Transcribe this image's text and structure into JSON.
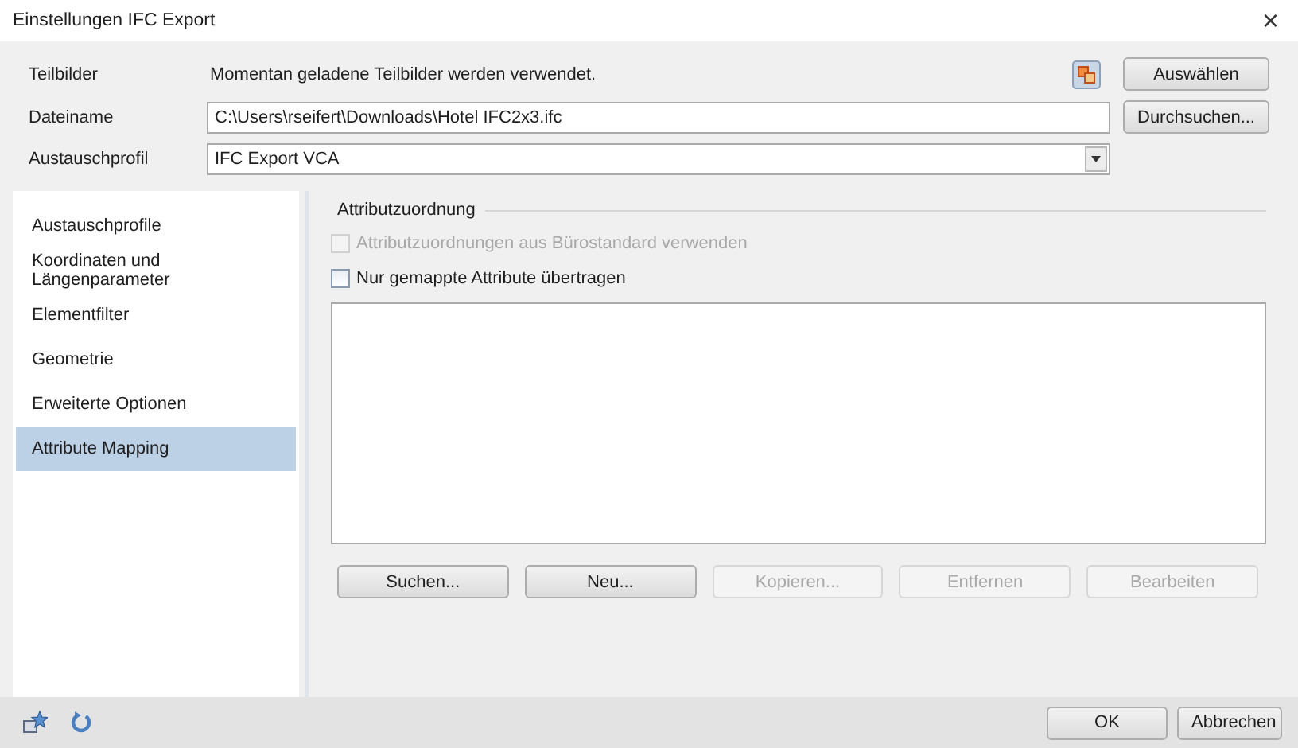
{
  "window": {
    "title": "Einstellungen IFC Export",
    "close": "×"
  },
  "form": {
    "teilbilder": {
      "label": "Teilbilder",
      "text": "Momentan geladene Teilbilder werden verwendet.",
      "button": "Auswählen"
    },
    "dateiname": {
      "label": "Dateiname",
      "value": "C:\\Users\\rseifert\\Downloads\\Hotel IFC2x3.ifc",
      "button": "Durchsuchen..."
    },
    "austauschprofil": {
      "label": "Austauschprofil",
      "value": "IFC Export VCA"
    }
  },
  "sidebar": {
    "items": [
      {
        "label": "Austauschprofile",
        "selected": false
      },
      {
        "label": "Koordinaten und Längenparameter",
        "selected": false
      },
      {
        "label": "Elementfilter",
        "selected": false
      },
      {
        "label": "Geometrie",
        "selected": false
      },
      {
        "label": "Erweiterte Optionen",
        "selected": false
      },
      {
        "label": "Attribute Mapping",
        "selected": true
      }
    ]
  },
  "panel": {
    "title": "Attributzuordnung",
    "checkboxes": [
      {
        "label": "Attributzuordnungen aus Bürostandard verwenden",
        "checked": false,
        "disabled": true
      },
      {
        "label": "Nur gemappte Attribute übertragen",
        "checked": false,
        "disabled": false
      }
    ],
    "buttons": [
      {
        "label": "Suchen...",
        "disabled": false
      },
      {
        "label": "Neu...",
        "disabled": false
      },
      {
        "label": "Kopieren...",
        "disabled": true
      },
      {
        "label": "Entfernen",
        "disabled": true
      },
      {
        "label": "Bearbeiten",
        "disabled": true
      }
    ]
  },
  "footer": {
    "buttons": [
      "OK",
      "Abbrechen"
    ]
  }
}
